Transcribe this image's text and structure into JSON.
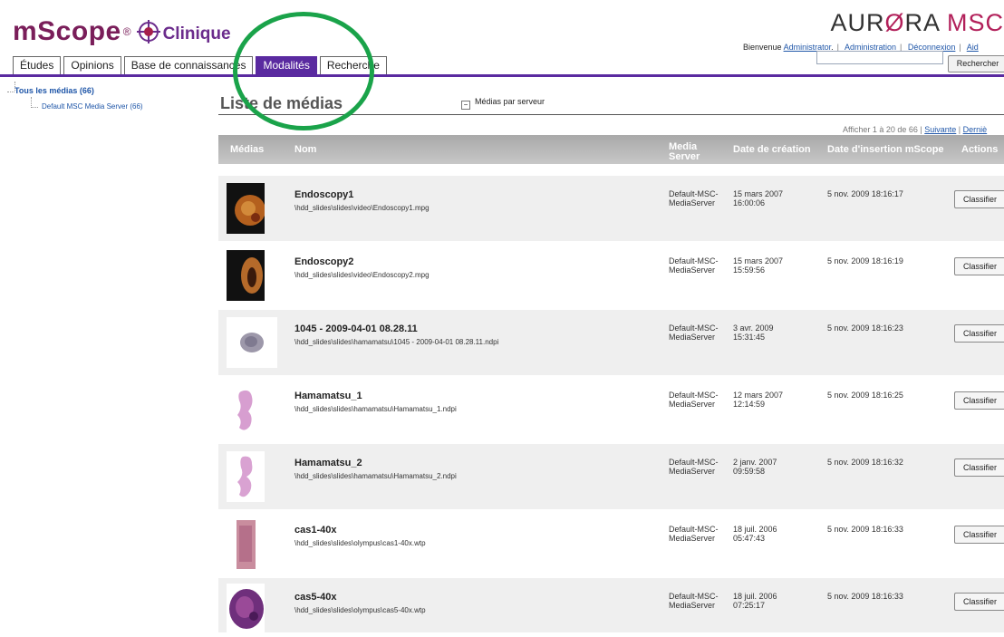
{
  "header": {
    "logo_text": "mScope",
    "logo_reg": "®",
    "logo_sub": "Clinique",
    "brand_parts": [
      "AUR",
      "Ø",
      "RA ",
      "MSC"
    ],
    "links": [
      "Bienvenue",
      "Administrator",
      "Administration",
      "Déconnexion",
      "Aid"
    ],
    "search_button": "Rechercher",
    "search_value": ""
  },
  "tabs": [
    {
      "label": "Études",
      "active": false
    },
    {
      "label": "Opinions",
      "active": false
    },
    {
      "label": "Base de connaissances",
      "active": false
    },
    {
      "label": "Modalités",
      "active": true
    },
    {
      "label": "Recherche",
      "active": false
    }
  ],
  "sidebar": {
    "all_media": "Tous les médias (66)",
    "by_server": "Médias par serveur",
    "server_node": "Default MSC Media Server (66)"
  },
  "main": {
    "title": "Liste de médias",
    "pager_text": "Afficher 1 à 20 de 66 |",
    "pager_next": "Suivante",
    "pager_last": "Derniè"
  },
  "table": {
    "headers": [
      "Médias",
      "Nom",
      "Media Server",
      "Date de création",
      "Date d'insertion mScope",
      "Actions"
    ],
    "rows": [
      {
        "name": "Endoscopy1",
        "path": "\\hdd_slides\\slides\\video\\Endoscopy1.mpg",
        "server": "Default-MSC-MediaServer",
        "created": "15 mars 2007 16:00:06",
        "inserted": "5 nov. 2009 18:16:17",
        "action": "Classifier",
        "thumb": "endo1"
      },
      {
        "name": "Endoscopy2",
        "path": "\\hdd_slides\\slides\\video\\Endoscopy2.mpg",
        "server": "Default-MSC-MediaServer",
        "created": "15 mars 2007 15:59:56",
        "inserted": "5 nov. 2009 18:16:19",
        "action": "Classifier",
        "thumb": "endo2"
      },
      {
        "name": "1045 - 2009-04-01 08.28.11",
        "path": "\\hdd_slides\\slides\\hamamatsu\\1045 - 2009-04-01 08.28.11.ndpi",
        "server": "Default-MSC-MediaServer",
        "created": "3 avr. 2009 15:31:45",
        "inserted": "5 nov. 2009 18:16:23",
        "action": "Classifier",
        "thumb": "gray"
      },
      {
        "name": "Hamamatsu_1",
        "path": "\\hdd_slides\\slides\\hamamatsu\\Hamamatsu_1.ndpi",
        "server": "Default-MSC-MediaServer",
        "created": "12 mars 2007 12:14:59",
        "inserted": "5 nov. 2009 18:16:25",
        "action": "Classifier",
        "thumb": "pink"
      },
      {
        "name": "Hamamatsu_2",
        "path": "\\hdd_slides\\slides\\hamamatsu\\Hamamatsu_2.ndpi",
        "server": "Default-MSC-MediaServer",
        "created": "2 janv. 2007 09:59:58",
        "inserted": "5 nov. 2009 18:16:32",
        "action": "Classifier",
        "thumb": "pink"
      },
      {
        "name": "cas1-40x",
        "path": "\\hdd_slides\\slides\\olympus\\cas1-40x.wtp",
        "server": "Default-MSC-MediaServer",
        "created": "18 juil. 2006 05:47:43",
        "inserted": "5 nov. 2009 18:16:33",
        "action": "Classifier",
        "thumb": "strip"
      },
      {
        "name": "cas5-40x",
        "path": "\\hdd_slides\\slides\\olympus\\cas5-40x.wtp",
        "server": "Default-MSC-MediaServer",
        "created": "18 juil. 2006 07:25:17",
        "inserted": "5 nov. 2009 18:16:33",
        "action": "Classifier",
        "thumb": "purple"
      }
    ]
  },
  "colors": {
    "accent": "#5a2aa0",
    "brand": "#7a1e5a",
    "link": "#1f56a8",
    "highlight": "#1aa34a"
  }
}
